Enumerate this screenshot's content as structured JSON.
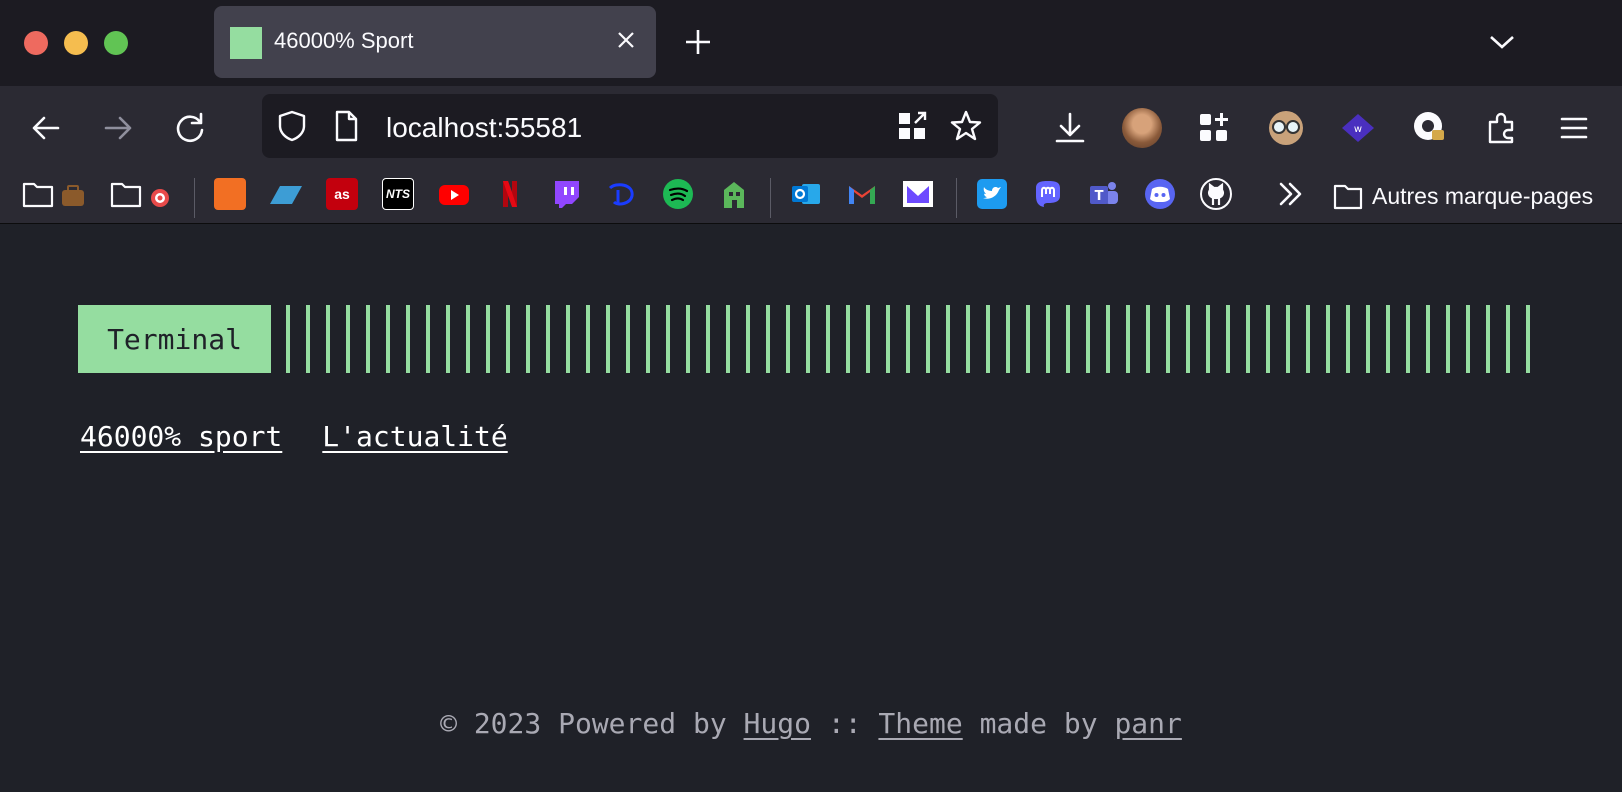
{
  "window": {
    "controls": [
      "close",
      "minimize",
      "zoom"
    ]
  },
  "tab": {
    "title": "46000% Sport",
    "favicon_color": "#95dda0"
  },
  "toolbar": {
    "url": "localhost:55581"
  },
  "bookmarks": {
    "items": [
      {
        "name": "folder-briefcase",
        "icon": "folder-icon"
      },
      {
        "name": "folder-target",
        "icon": "folder-icon"
      },
      {
        "name": "soundcloud",
        "color": "#f26f23"
      },
      {
        "name": "bookmark-parallelogram",
        "color": "#3d9dd5"
      },
      {
        "name": "lastfm",
        "color": "#c3000d"
      },
      {
        "name": "nts",
        "color": "#000000"
      },
      {
        "name": "youtube",
        "color": "#ff0000"
      },
      {
        "name": "netflix",
        "color": "#e50914"
      },
      {
        "name": "twitch",
        "color": "#9146ff"
      },
      {
        "name": "disney-plus",
        "color": "#1a3cff"
      },
      {
        "name": "spotify",
        "color": "#1db954"
      },
      {
        "name": "bookmark-green-building",
        "color": "#5bb75b"
      },
      {
        "name": "outlook",
        "color": "#0078d4"
      },
      {
        "name": "gmail",
        "color": "#ea4335"
      },
      {
        "name": "protonmail",
        "color": "#6d4aff"
      },
      {
        "name": "twitter",
        "color": "#1d9bf0"
      },
      {
        "name": "mastodon",
        "color": "#6364ff"
      },
      {
        "name": "teams",
        "color": "#5059c9"
      },
      {
        "name": "discord",
        "color": "#5865f2"
      },
      {
        "name": "github",
        "color": "#ffffff"
      }
    ],
    "other_label": "Autres marque-pages"
  },
  "page": {
    "logo": "Terminal",
    "accent_color": "#95dda0",
    "menu": [
      {
        "label": "46000% sport"
      },
      {
        "label": "L'actualité"
      }
    ],
    "footer": {
      "copyright": "© 2023 Powered by",
      "hugo": "Hugo",
      "separator": "::",
      "theme": "Theme",
      "made_by": "made by",
      "author": "panr"
    }
  }
}
